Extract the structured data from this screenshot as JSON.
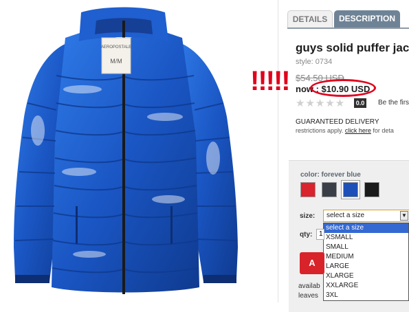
{
  "tabs": [
    {
      "label": "DETAILS",
      "active": true
    },
    {
      "label": "DESCRIPTION",
      "active": false
    }
  ],
  "product": {
    "title": "guys solid puffer jacke",
    "style": "style: 0734",
    "was_price": "$54.50 USD",
    "now_price": "now : $10.90 USD",
    "image_tag_brand": "AEROPOSTALE",
    "image_tag_size": "M/M"
  },
  "annotation": {
    "exclamation": "!!!!!",
    "circle_color": "#e0001b"
  },
  "rating": {
    "stars_filled": 0,
    "stars_total": 5,
    "score": "0.0",
    "be_first_text": "Be the firs"
  },
  "delivery": {
    "title": "GUARANTEED DELIVERY",
    "restrictions_prefix": "restrictions apply.",
    "link": "click here",
    "suffix": "for deta"
  },
  "options": {
    "color_label": "color: forever blue",
    "swatches": [
      {
        "name": "red",
        "hex": "#d9232d"
      },
      {
        "name": "charcoal",
        "hex": "#3a3f47"
      },
      {
        "name": "forever blue",
        "hex": "#1d4fb8",
        "selected": true
      },
      {
        "name": "black",
        "hex": "#1a1a1a"
      }
    ],
    "size_label": "size:",
    "size_selected": "select a size",
    "size_options": [
      "select a size",
      "XSMALL",
      "SMALL",
      "MEDIUM",
      "LARGE",
      "XLARGE",
      "XXLARGE",
      "3XL"
    ],
    "qty_label": "qty:",
    "qty_value": "1",
    "add_label": "A",
    "avail_line1": "availab",
    "avail_line2": "leaves"
  },
  "colors": {
    "accent_red": "#e0001b",
    "tab_blue": "#6f8396",
    "jacket_blue": "#1f5fcf"
  }
}
